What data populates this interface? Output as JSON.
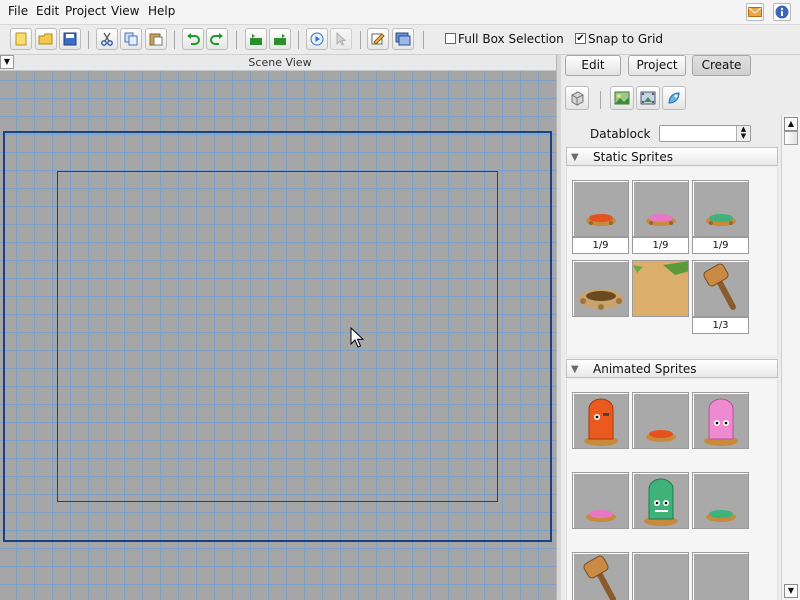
{
  "menu": [
    "File",
    "Edit",
    "Project",
    "View",
    "Help"
  ],
  "toolbar": {
    "full_box_selection": {
      "label": "Full Box Selection",
      "checked": false
    },
    "snap_to_grid": {
      "label": "Snap to Grid",
      "checked": true
    }
  },
  "scene": {
    "title": "Scene View"
  },
  "panel": {
    "tabs": [
      "Edit",
      "Project",
      "Create"
    ],
    "active_tab": "Create",
    "datablock_label": "Datablock",
    "datablock_value": "",
    "static_section": "Static Sprites",
    "animated_section": "Animated Sprites",
    "static_sprites": [
      {
        "label": "1/9"
      },
      {
        "label": "1/9"
      },
      {
        "label": "1/9"
      },
      {
        "label": ""
      },
      {
        "label": ""
      },
      {
        "label": "1/3"
      }
    ]
  },
  "colors": {
    "grid_line": "#7ea1c7",
    "scene_bg": "#a6a6a6",
    "camera_bounds": "#1d3f86"
  }
}
